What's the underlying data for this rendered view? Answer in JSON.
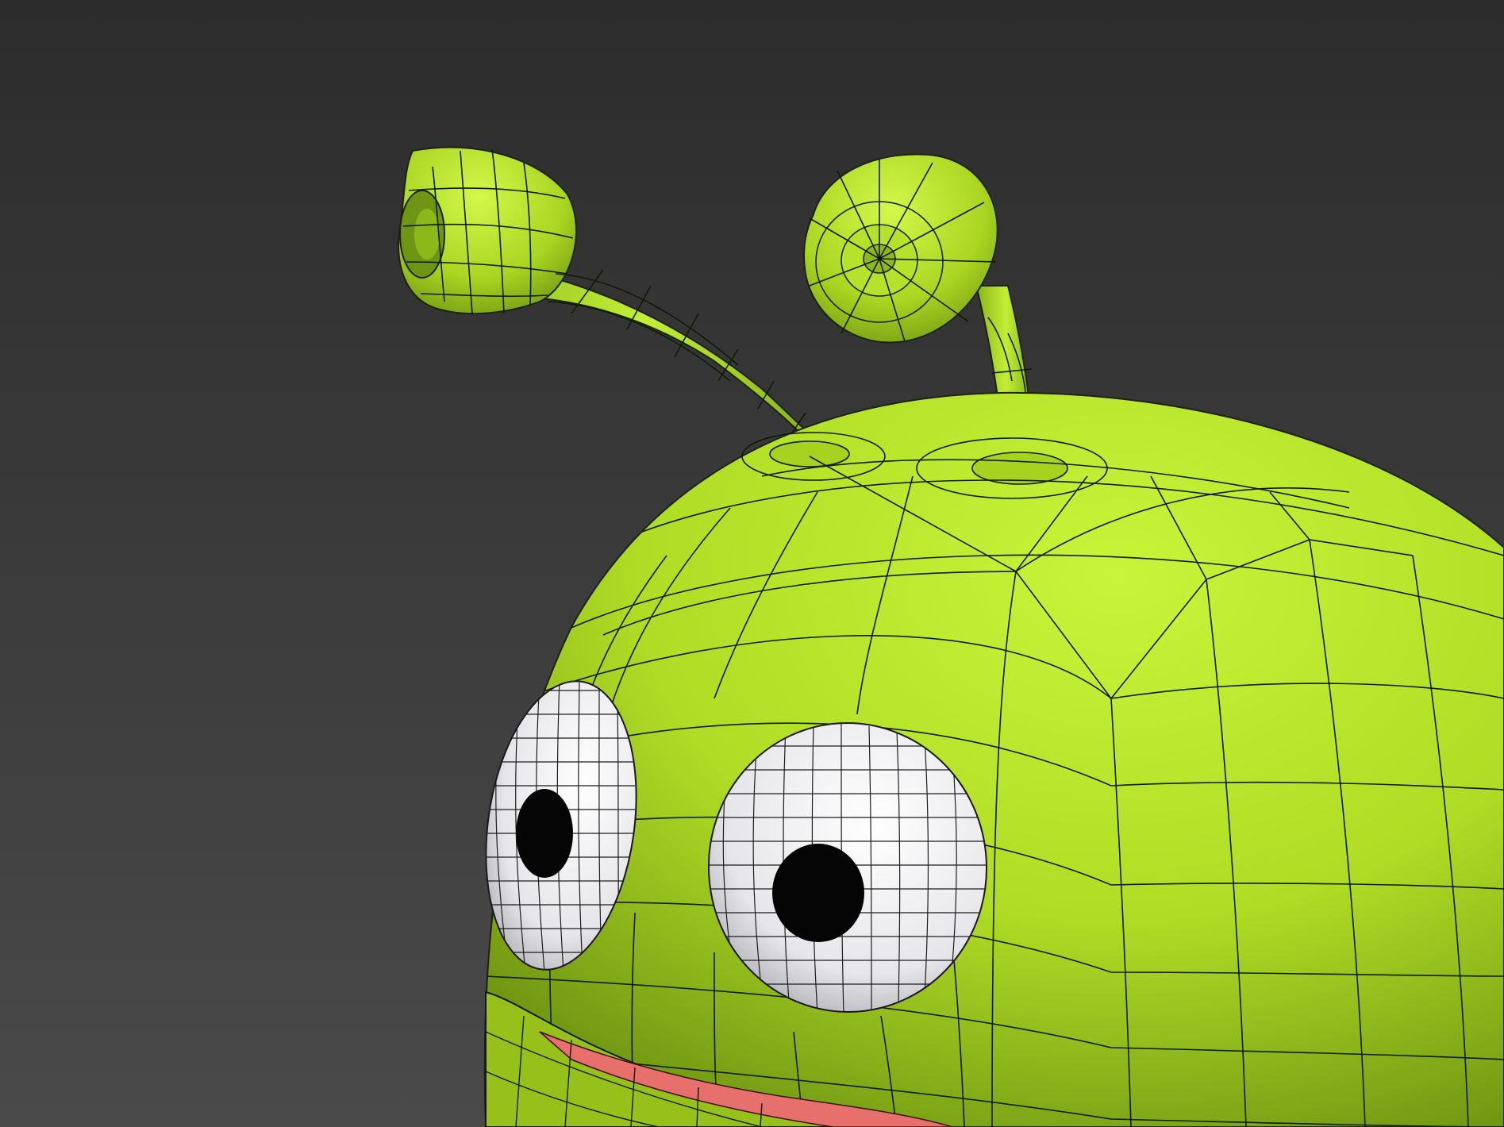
{
  "scene": {
    "subject": "green-alien-character-wireframe",
    "colors": {
      "background_top": "#2e2e2e",
      "background_bottom": "#474747",
      "body_light": "#c6f23a",
      "body_mid": "#a9d61f",
      "body_dark": "#6f9612",
      "wire": "#111a05",
      "eye_white": "#f1f1f4",
      "eye_shade": "#b9b9c0",
      "pupil": "#050505",
      "mouth": "#e86a68"
    }
  }
}
